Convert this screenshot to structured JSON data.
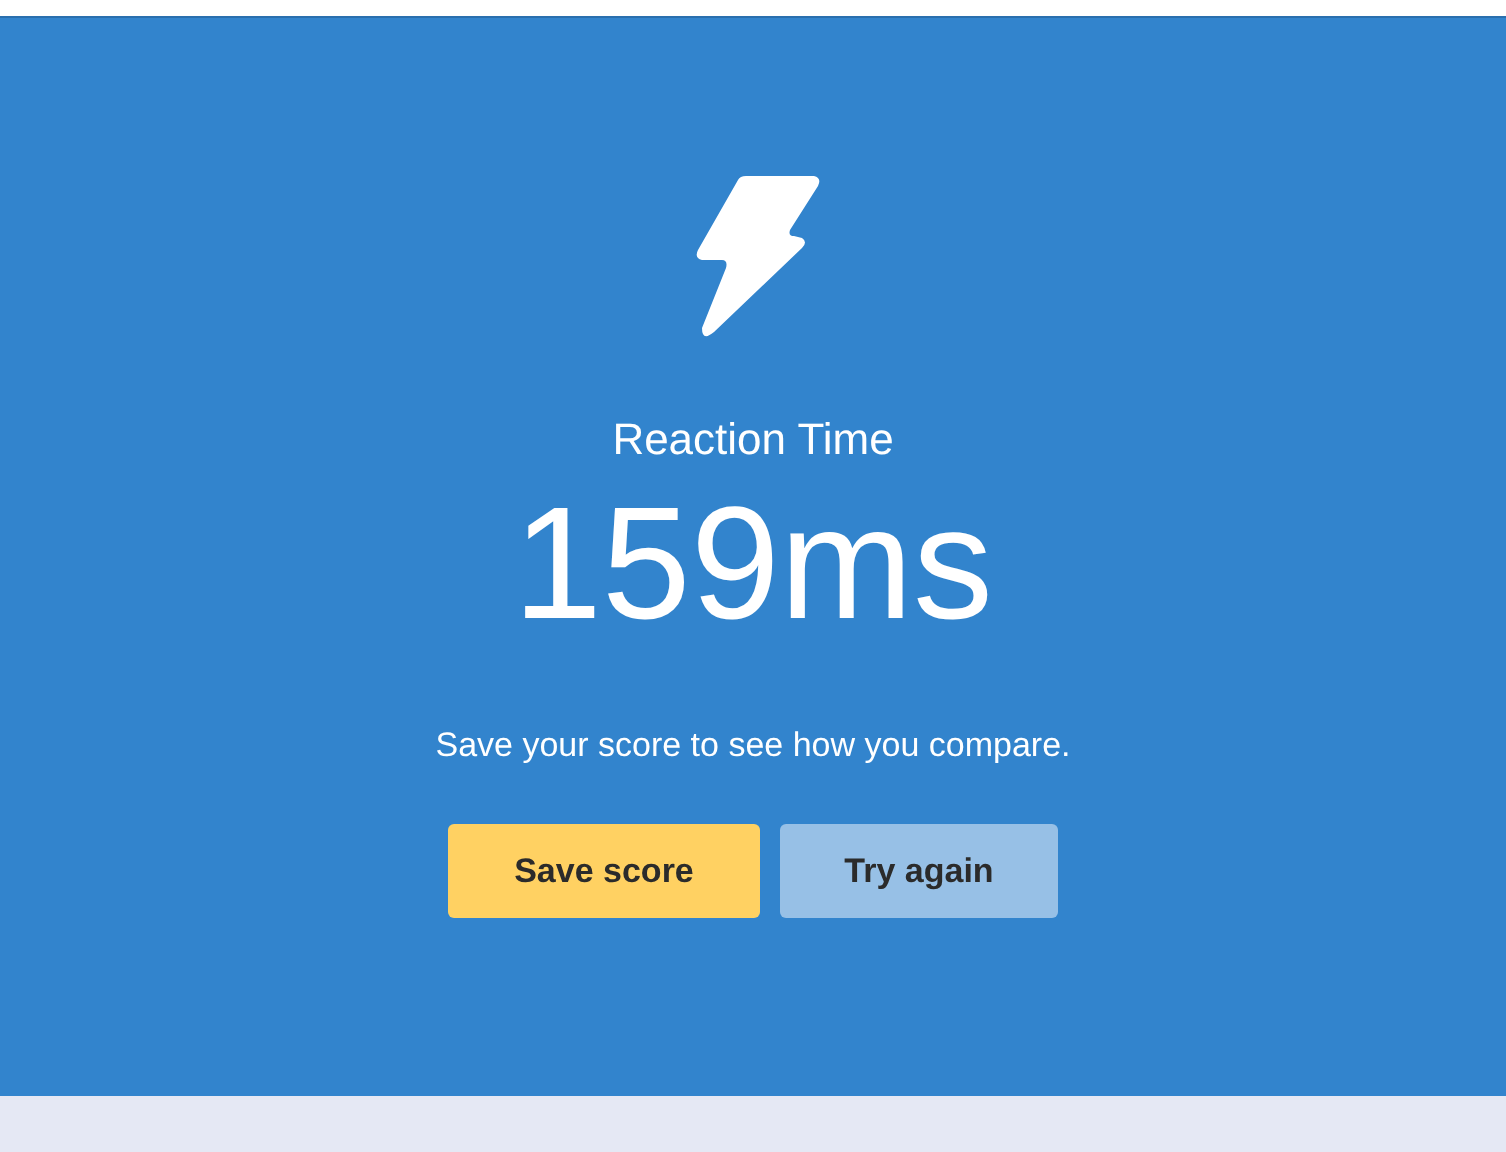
{
  "result": {
    "title": "Reaction Time",
    "score": "159ms",
    "message": "Save your score to see how you compare."
  },
  "buttons": [
    {
      "label": "Save score",
      "kind": "primary"
    },
    {
      "label": "Try again",
      "kind": "secondary"
    }
  ]
}
